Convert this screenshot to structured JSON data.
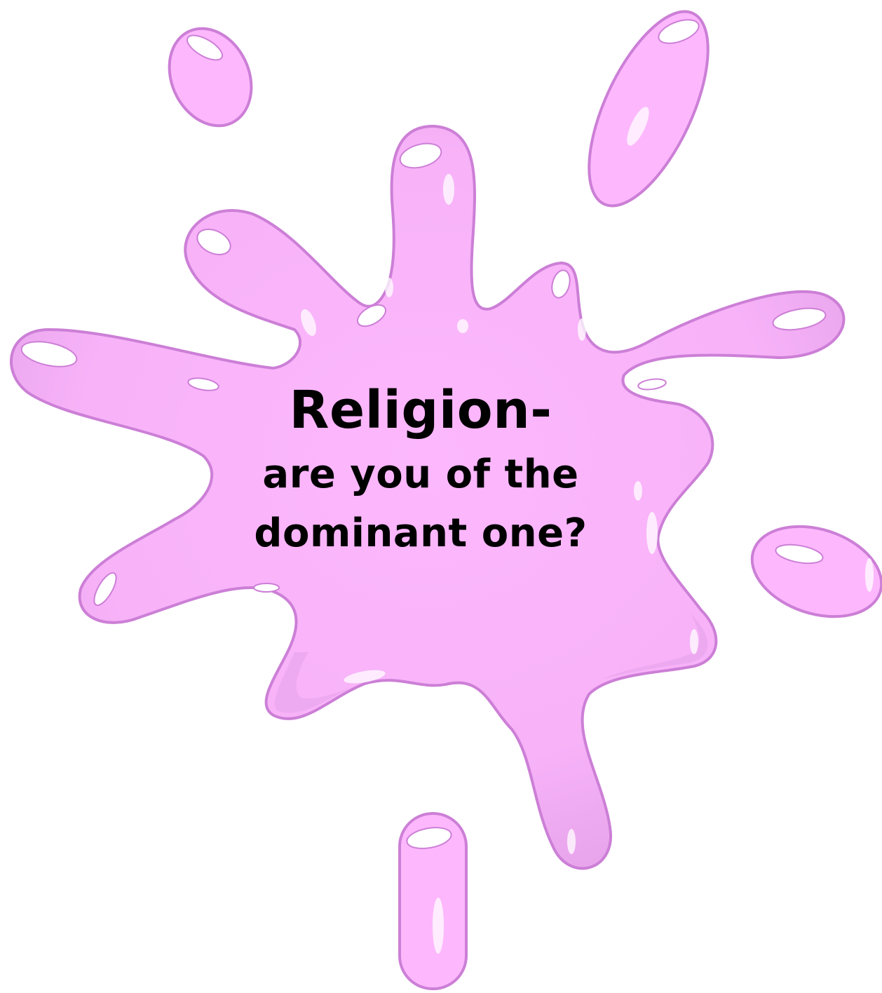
{
  "caption": {
    "title": "Religion-",
    "line1": "are you of the",
    "line2": "dominant one?"
  },
  "colors": {
    "splat_fill": "#fdb8fd",
    "splat_shade": "#e6a3ea",
    "splat_outline": "#cc7fd6",
    "highlight": "#ffffff",
    "text": "#000000",
    "background": "#ffffff"
  }
}
